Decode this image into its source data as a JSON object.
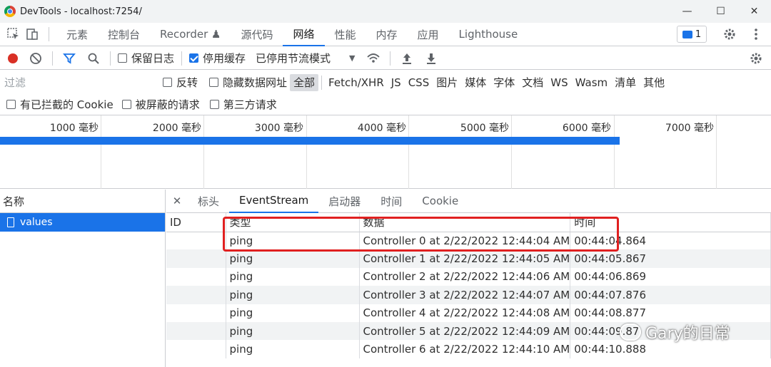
{
  "window": {
    "title": "DevTools - localhost:7254/",
    "controls": [
      "—",
      "☐",
      "✕"
    ]
  },
  "main_tabs": [
    {
      "label": "元素"
    },
    {
      "label": "控制台"
    },
    {
      "label": "Recorder ♟"
    },
    {
      "label": "源代码"
    },
    {
      "label": "网络",
      "active": true
    },
    {
      "label": "性能"
    },
    {
      "label": "内存"
    },
    {
      "label": "应用"
    },
    {
      "label": "Lighthouse"
    }
  ],
  "issues_count": "1",
  "toolbar": {
    "preserve_log": "保留日志",
    "disable_cache": "停用缓存",
    "throttling": "已停用节流模式"
  },
  "filter": {
    "placeholder": "过滤",
    "invert": "反转",
    "hide_data_urls": "隐藏数据网址",
    "types": [
      "全部",
      "Fetch/XHR",
      "JS",
      "CSS",
      "图片",
      "媒体",
      "字体",
      "文档",
      "WS",
      "Wasm",
      "清单",
      "其他"
    ],
    "blocked_cookies": "有已拦截的 Cookie",
    "blocked_requests": "被屏蔽的请求",
    "third_party": "第三方请求"
  },
  "timeline": {
    "ticks": [
      "1000 毫秒",
      "2000 毫秒",
      "3000 毫秒",
      "4000 毫秒",
      "5000 毫秒",
      "6000 毫秒",
      "7000 毫秒"
    ]
  },
  "names": {
    "header": "名称",
    "items": [
      "values"
    ]
  },
  "detail": {
    "tabs": [
      "标头",
      "EventStream",
      "启动器",
      "时间",
      "Cookie"
    ],
    "active_tab": "EventStream",
    "columns": [
      "ID",
      "类型",
      "数据",
      "时间"
    ],
    "rows": [
      {
        "id": "",
        "type": "ping",
        "data": "Controller 0 at 2/22/2022 12:44:04 AM",
        "time": "00:44:04.864"
      },
      {
        "id": "",
        "type": "ping",
        "data": "Controller 1 at 2/22/2022 12:44:05 AM",
        "time": "00:44:05.867"
      },
      {
        "id": "",
        "type": "ping",
        "data": "Controller 2 at 2/22/2022 12:44:06 AM",
        "time": "00:44:06.869"
      },
      {
        "id": "",
        "type": "ping",
        "data": "Controller 3 at 2/22/2022 12:44:07 AM",
        "time": "00:44:07.876"
      },
      {
        "id": "",
        "type": "ping",
        "data": "Controller 4 at 2/22/2022 12:44:08 AM",
        "time": "00:44:08.877"
      },
      {
        "id": "",
        "type": "ping",
        "data": "Controller 5 at 2/22/2022 12:44:09 AM",
        "time": "00:44:09.87"
      },
      {
        "id": "",
        "type": "ping",
        "data": "Controller 6 at 2/22/2022 12:44:10 AM",
        "time": "00:44:10.888"
      }
    ]
  },
  "watermark": "Gary的日常",
  "colors": {
    "accent": "#1a73e8",
    "record": "#d93025",
    "annotation": "#e02020"
  }
}
